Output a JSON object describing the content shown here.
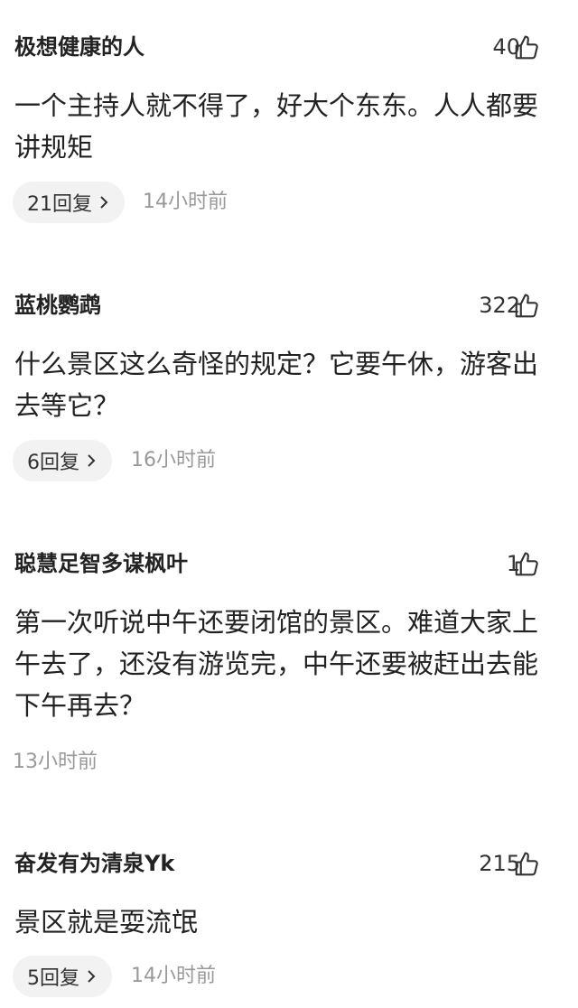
{
  "comments": [
    {
      "username": "极想健康的人",
      "likes": "40",
      "text": "一个主持人就不得了，好大个东东。人人都要讲规矩",
      "replies": "21回复",
      "time": "14小时前"
    },
    {
      "username": "蓝桃鹦鹉",
      "likes": "322",
      "text": "什么景区这么奇怪的规定？它要午休，游客出去等它？",
      "replies": "6回复",
      "time": "16小时前"
    },
    {
      "username": "聪慧足智多谋枫叶",
      "likes": "1",
      "text": "第一次听说中午还要闭馆的景区。难道大家上午去了，还没有游览完，中午还要被赶出去能下午再去？",
      "replies": "",
      "time": "13小时前"
    },
    {
      "username": "奋发有为清泉Yk",
      "likes": "215",
      "text": "景区就是耍流氓",
      "replies": "5回复",
      "time": "14小时前"
    }
  ],
  "icons": {
    "like": "thumbs-up-icon",
    "reply_chevron": "chevron-right-icon"
  }
}
